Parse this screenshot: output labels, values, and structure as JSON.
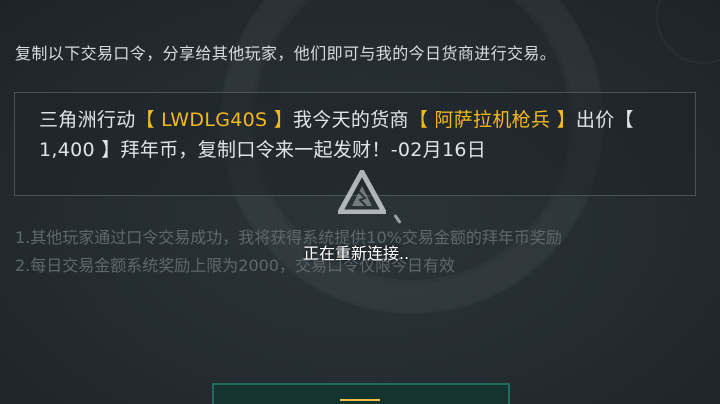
{
  "header": {
    "instruction": "复制以下交易口令，分享给其他玩家，他们即可与我的今日货商进行交易。"
  },
  "code_box": {
    "part1": "三角洲行动",
    "code": "【 LWDLG40S 】",
    "part2": "我今天的货商",
    "merchant": "【 阿萨拉机枪兵 】",
    "part3": "出价【 1,400 】拜年币，复制口令来一起发财！-02月16日"
  },
  "notes": {
    "line1": "1.其他玩家通过口令交易成功，我将获得系统提供10%交易金额的拜年币奖励",
    "line2": "2.每日交易金额系统奖励上限为2000，交易口令仅限今日有效"
  },
  "overlay": {
    "status": "正在重新连接.."
  },
  "colors": {
    "accent": "#f2b81e",
    "button_border": "#1f6b5e"
  },
  "icons": {
    "loading": "loading-logo-icon"
  }
}
